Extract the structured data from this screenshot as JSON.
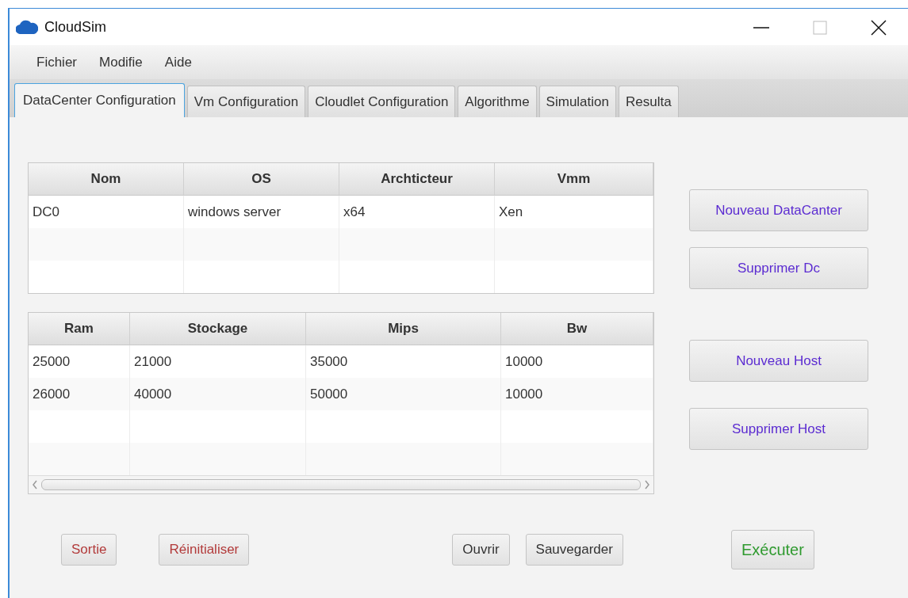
{
  "window": {
    "title": "CloudSim"
  },
  "menu": [
    "Fichier",
    "Modifie",
    "Aide"
  ],
  "tabs": [
    {
      "label": "DataCenter Configuration",
      "selected": true
    },
    {
      "label": "Vm Configuration",
      "selected": false
    },
    {
      "label": "Cloudlet Configuration",
      "selected": false
    },
    {
      "label": "Algorithme",
      "selected": false
    },
    {
      "label": "Simulation",
      "selected": false
    },
    {
      "label": "Resulta",
      "selected": false
    }
  ],
  "datacenter_table": {
    "columns": [
      "Nom",
      "OS",
      "Archticteur",
      "Vmm"
    ],
    "rows": [
      [
        "DC0",
        "windows server",
        "x64",
        "Xen"
      ]
    ]
  },
  "host_table": {
    "columns": [
      "Ram",
      "Stockage",
      "Mips",
      "Bw"
    ],
    "rows": [
      [
        "25000",
        "21000",
        "35000",
        "10000"
      ],
      [
        "26000",
        "40000",
        "50000",
        "10000"
      ]
    ]
  },
  "side_buttons": [
    {
      "label": "Nouveau DataCanter",
      "kind": "action"
    },
    {
      "label": "Supprimer Dc",
      "kind": "action"
    },
    {
      "label": "Nouveau Host",
      "kind": "action"
    },
    {
      "label": "Supprimer Host",
      "kind": "action"
    }
  ],
  "bottom_buttons": [
    {
      "label": "Sortie",
      "kind": "danger"
    },
    {
      "label": "Réinitialiser",
      "kind": "danger"
    },
    {
      "label": "Ouvrir",
      "kind": "plain"
    },
    {
      "label": "Sauvegarder",
      "kind": "plain"
    },
    {
      "label": "Exécuter",
      "kind": "run"
    }
  ]
}
